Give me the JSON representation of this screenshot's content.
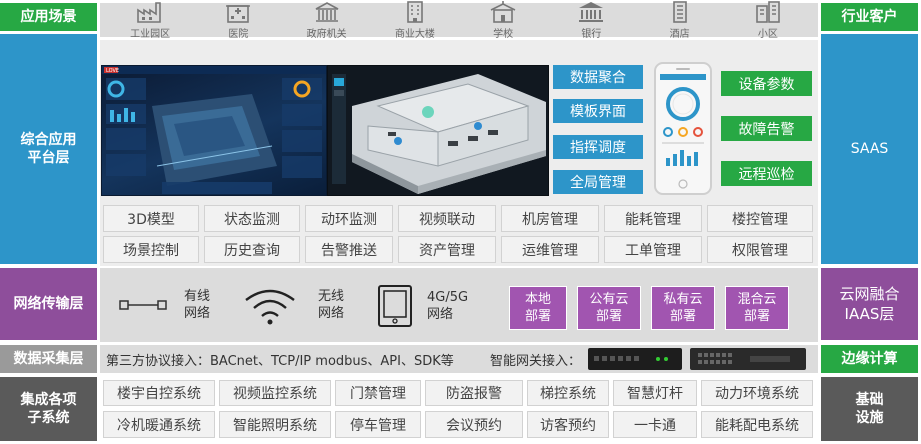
{
  "left_labels": {
    "scenes": "应用场景",
    "platform": "综合应用\n平台层",
    "network": "网络传输层",
    "collect": "数据采集层",
    "integration": "集成各项\n子系统"
  },
  "right_labels": {
    "customers": "行业客户",
    "saas": "SAAS",
    "iaas": "云网融合\nIAAS层",
    "edge": "边缘计算",
    "infra": "基础\n设施"
  },
  "scenes": [
    {
      "label": "工业园区",
      "icon": "factory-icon"
    },
    {
      "label": "医院",
      "icon": "hospital-icon"
    },
    {
      "label": "政府机关",
      "icon": "government-icon"
    },
    {
      "label": "商业大楼",
      "icon": "building-icon"
    },
    {
      "label": "学校",
      "icon": "school-icon"
    },
    {
      "label": "银行",
      "icon": "bank-icon"
    },
    {
      "label": "酒店",
      "icon": "hotel-icon"
    },
    {
      "label": "小区",
      "icon": "residential-icon"
    }
  ],
  "platform": {
    "dashboard_badge": "LOVE",
    "blue_buttons": [
      "数据聚合",
      "模板界面",
      "指挥调度",
      "全局管理"
    ],
    "green_buttons": [
      "设备参数",
      "故障告警",
      "远程巡检"
    ],
    "features_row1": [
      "3D模型",
      "状态监测",
      "动环监测",
      "视频联动",
      "机房管理",
      "能耗管理",
      "楼控管理"
    ],
    "features_row2": [
      "场景控制",
      "历史查询",
      "告警推送",
      "资产管理",
      "运维管理",
      "工单管理",
      "权限管理"
    ]
  },
  "network": {
    "wired": "有线\n网络",
    "wireless": "无线\n网络",
    "cellular": "4G/5G\n网络",
    "deployments": [
      "本地\n部署",
      "公有云\n部署",
      "私有云\n部署",
      "混合云\n部署"
    ]
  },
  "collect": {
    "protocols": "第三方协议接入：BACnet、TCP/IP modbus、API、SDK等",
    "gateway": "智能网关接入："
  },
  "subsystems": {
    "row1": [
      "楼宇自控系统",
      "视频监控系统",
      "门禁管理",
      "防盗报警",
      "梯控系统",
      "智慧灯杆",
      "动力环境系统"
    ],
    "row2": [
      "冷机暖通系统",
      "智能照明系统",
      "停车管理",
      "会议预约",
      "访客预约",
      "一卡通",
      "能耗配电系统"
    ]
  },
  "colors": {
    "green": "#27a844",
    "blue": "#2d95c9",
    "purple": "#8e4e9b",
    "purple_button": "#a155b0",
    "panel_grey": "#dcdcdc"
  }
}
